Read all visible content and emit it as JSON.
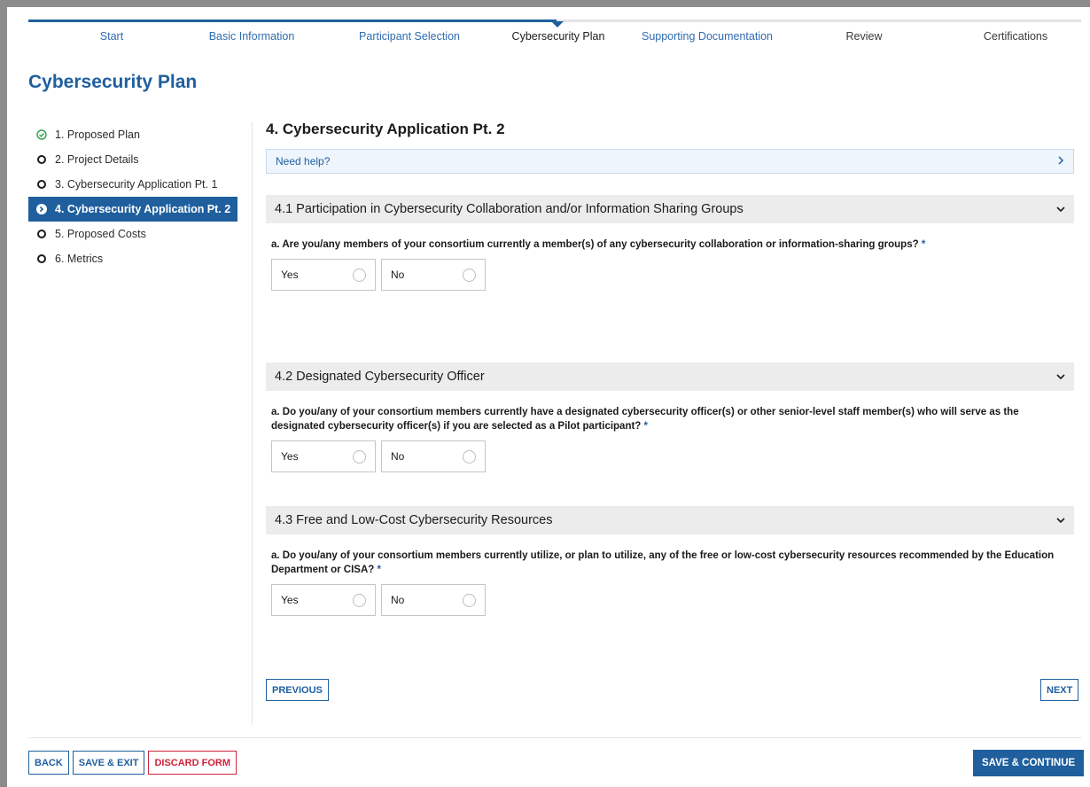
{
  "stepper": {
    "steps": [
      {
        "label": "Start"
      },
      {
        "label": "Basic Information"
      },
      {
        "label": "Participant Selection"
      },
      {
        "label": "Cybersecurity Plan"
      },
      {
        "label": "Supporting Documentation"
      },
      {
        "label": "Review"
      },
      {
        "label": "Certifications"
      }
    ]
  },
  "page": {
    "title": "Cybersecurity Plan"
  },
  "sidebar": {
    "items": [
      {
        "label": "1. Proposed Plan",
        "icon": "check-circle-icon"
      },
      {
        "label": "2. Project Details",
        "icon": "circle-outline-icon"
      },
      {
        "label": "3. Cybersecurity Application Pt. 1",
        "icon": "circle-outline-icon"
      },
      {
        "label": "4. Cybersecurity Application Pt. 2",
        "icon": "arrow-circle-icon"
      },
      {
        "label": "5. Proposed Costs",
        "icon": "circle-outline-icon"
      },
      {
        "label": "6. Metrics",
        "icon": "circle-outline-icon"
      }
    ]
  },
  "main": {
    "title": "4. Cybersecurity Application Pt. 2",
    "help_label": "Need help?",
    "sections": [
      {
        "header": "4.1 Participation in Cybersecurity Collaboration and/or Information Sharing Groups",
        "question": "a. Are you/any members of your consortium currently a member(s) of any cybersecurity collaboration or information-sharing groups?",
        "required_mark": "*",
        "options": [
          "Yes",
          "No"
        ]
      },
      {
        "header": "4.2 Designated Cybersecurity Officer",
        "question": "a. Do you/any of your consortium members currently have a designated cybersecurity officer(s) or other senior-level staff member(s) who will serve as the designated cybersecurity officer(s) if you are selected as a Pilot participant?",
        "required_mark": "*",
        "options": [
          "Yes",
          "No"
        ]
      },
      {
        "header": "4.3 Free and Low-Cost Cybersecurity Resources",
        "question": "a. Do you/any of your consortium members currently utilize, or plan to utilize, any of the free or low-cost cybersecurity resources recommended by the Education Department or CISA?",
        "required_mark": "*",
        "options": [
          "Yes",
          "No"
        ]
      }
    ],
    "previous_label": "PREVIOUS",
    "next_label": "NEXT"
  },
  "footer": {
    "back_label": "BACK",
    "save_exit_label": "SAVE & EXIT",
    "discard_label": "DISCARD FORM",
    "save_continue_label": "SAVE & CONTINUE"
  },
  "colors": {
    "primary": "#1f5f9e",
    "danger": "#d0223d",
    "success": "#2e9e4f"
  }
}
